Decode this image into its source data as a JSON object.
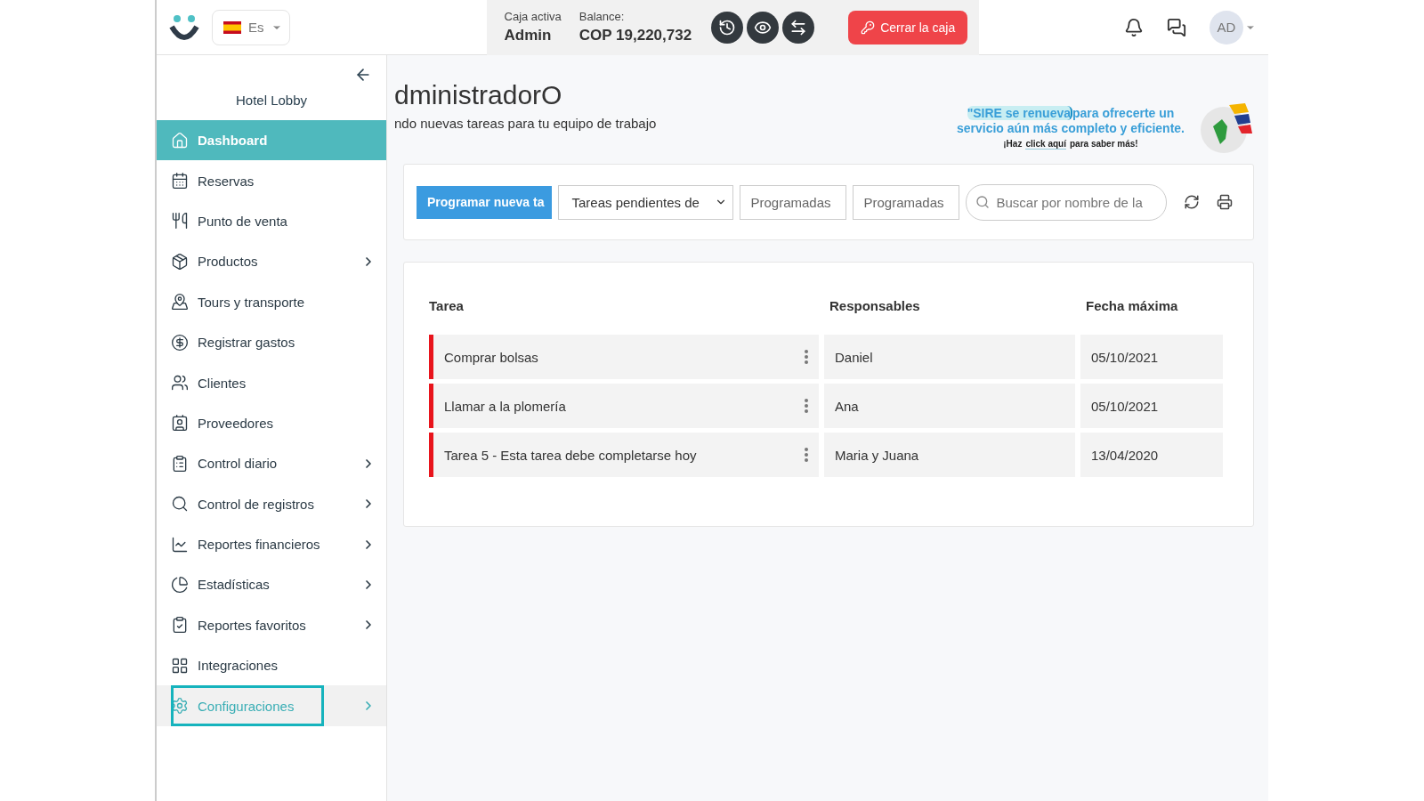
{
  "header": {
    "language": "Es",
    "cash_register": {
      "label": "Caja activa",
      "value": "Admin"
    },
    "balance": {
      "label": "Balance:",
      "value": "COP 19,220,732"
    },
    "close_button": "Cerrar la caja",
    "avatar": "AD"
  },
  "sidebar": {
    "property": "Hotel Lobby",
    "items": [
      {
        "label": "Dashboard",
        "selected": true,
        "highlighted": false,
        "has_submenu": false
      },
      {
        "label": "Reservas",
        "selected": false,
        "highlighted": false,
        "has_submenu": false
      },
      {
        "label": "Punto de venta",
        "selected": false,
        "highlighted": false,
        "has_submenu": false
      },
      {
        "label": "Productos",
        "selected": false,
        "highlighted": false,
        "has_submenu": true
      },
      {
        "label": "Tours y transporte",
        "selected": false,
        "highlighted": false,
        "has_submenu": false
      },
      {
        "label": "Registrar gastos",
        "selected": false,
        "highlighted": false,
        "has_submenu": false
      },
      {
        "label": "Clientes",
        "selected": false,
        "highlighted": false,
        "has_submenu": false
      },
      {
        "label": "Proveedores",
        "selected": false,
        "highlighted": false,
        "has_submenu": false
      },
      {
        "label": "Control diario",
        "selected": false,
        "highlighted": false,
        "has_submenu": true
      },
      {
        "label": "Control de registros",
        "selected": false,
        "highlighted": false,
        "has_submenu": true
      },
      {
        "label": "Reportes financieros",
        "selected": false,
        "highlighted": false,
        "has_submenu": true
      },
      {
        "label": "Estadísticas",
        "selected": false,
        "highlighted": false,
        "has_submenu": true
      },
      {
        "label": "Reportes favoritos",
        "selected": false,
        "highlighted": false,
        "has_submenu": true
      },
      {
        "label": "Integraciones",
        "selected": false,
        "highlighted": false,
        "has_submenu": false
      },
      {
        "label": "Configuraciones",
        "selected": false,
        "highlighted": true,
        "has_submenu": true
      }
    ]
  },
  "page": {
    "title": "dministradorO",
    "subtitle": "ndo nuevas tareas para tu equipo de trabajo"
  },
  "banner": {
    "highlight": "\"SIRE se renueva",
    "text": "para ofrecerte un servicio aún más completo y eficiente.",
    "link_prefix": "¡Haz",
    "link": "click aquí",
    "link_suffix": "para saber más!"
  },
  "toolbar": {
    "new_button": "Programar nueva ta",
    "filter": "Tareas pendientes de",
    "field_1": "Programadas",
    "field_2": "Programadas",
    "search_placeholder": "Buscar por nombre de la"
  },
  "table": {
    "columns": [
      "Tarea",
      "Responsables",
      "Fecha máxima"
    ],
    "rows": [
      {
        "task": "Comprar bolsas",
        "assignees": "Daniel",
        "due": "05/10/2021"
      },
      {
        "task": "Llamar a la plomería",
        "assignees": "Ana",
        "due": "05/10/2021"
      },
      {
        "task": "Tarea 5 - Esta tarea debe completarse hoy",
        "assignees": "Maria y Juana",
        "due": "13/04/2020"
      }
    ]
  }
}
